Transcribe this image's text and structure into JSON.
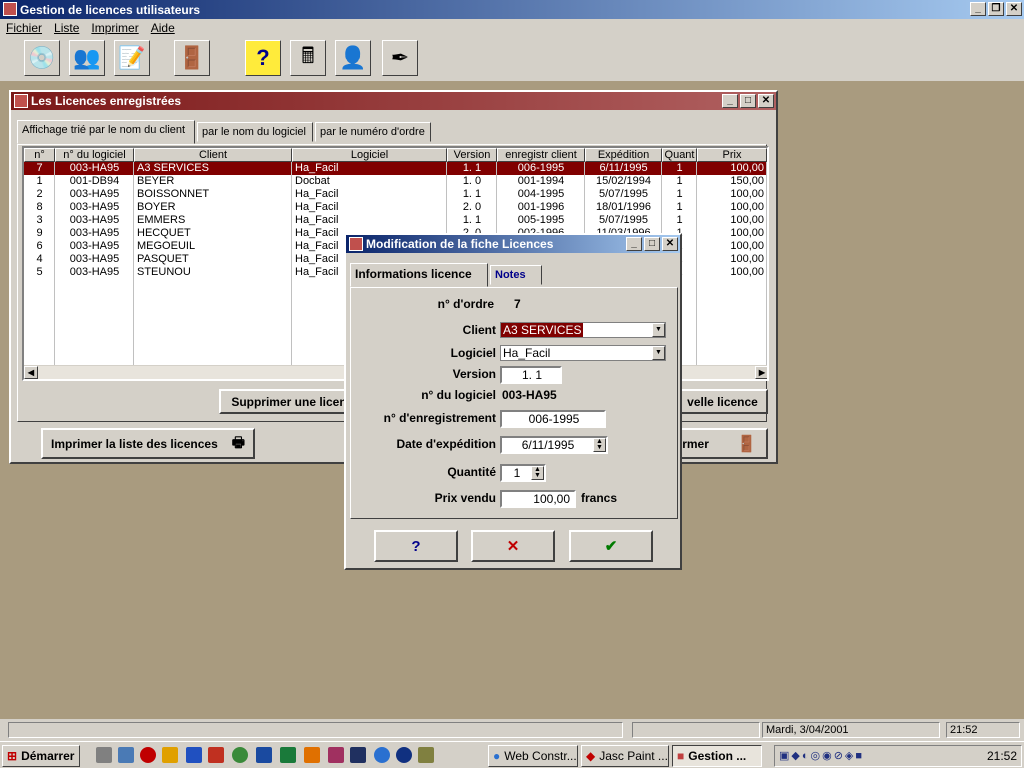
{
  "app": {
    "title": "Gestion de licences utilisateurs"
  },
  "menu": [
    "Fichier",
    "Liste",
    "Imprimer",
    "Aide"
  ],
  "toolbar_icons": [
    "cd-icon",
    "users-icon",
    "edit-icon",
    "exit-door-icon",
    "help-icon",
    "calculator-icon",
    "person-icon",
    "pen-icon"
  ],
  "licences_window": {
    "title": "Les Licences enregistrées",
    "tabs": [
      "Affichage trié par le nom du client",
      "par le nom du logiciel",
      "par le numéro d'ordre"
    ],
    "columns": [
      "n°",
      "n° du logiciel",
      "Client",
      "Logiciel",
      "Version",
      "enregistr client",
      "Expédition",
      "Quant",
      "Prix"
    ],
    "rows": [
      [
        "7",
        "003-HA95",
        "A3 SERVICES",
        "Ha_Facil",
        "1. 1",
        "006-1995",
        "6/11/1995",
        "1",
        "100,00"
      ],
      [
        "1",
        "001-DB94",
        "BEYER",
        "Docbat",
        "1. 0",
        "001-1994",
        "15/02/1994",
        "1",
        "150,00"
      ],
      [
        "2",
        "003-HA95",
        "BOISSONNET",
        "Ha_Facil",
        "1. 1",
        "004-1995",
        "5/07/1995",
        "1",
        "100,00"
      ],
      [
        "8",
        "003-HA95",
        "BOYER",
        "Ha_Facil",
        "2. 0",
        "001-1996",
        "18/01/1996",
        "1",
        "100,00"
      ],
      [
        "3",
        "003-HA95",
        "EMMERS",
        "Ha_Facil",
        "1. 1",
        "005-1995",
        "5/07/1995",
        "1",
        "100,00"
      ],
      [
        "9",
        "003-HA95",
        "HECQUET",
        "Ha_Facil",
        "2. 0",
        "002-1996",
        "11/03/1996",
        "1",
        "100,00"
      ],
      [
        "6",
        "003-HA95",
        "MEGOEUIL",
        "Ha_Facil",
        "",
        "",
        "",
        "1",
        "100,00"
      ],
      [
        "4",
        "003-HA95",
        "PASQUET",
        "Ha_Facil",
        "",
        "",
        "",
        "1",
        "100,00"
      ],
      [
        "5",
        "003-HA95",
        "STEUNOU",
        "Ha_Facil",
        "",
        "",
        "",
        "1",
        "100,00"
      ]
    ],
    "btn_delete": "Supprimer une licen",
    "btn_new": "velle licence",
    "btn_print": "Imprimer la liste des licences",
    "btn_close": "rmer"
  },
  "dialog": {
    "title": "Modification de la fiche Licences",
    "tabs": [
      "Informations licence",
      "Notes"
    ],
    "fields": {
      "ordre_label": "n° d'ordre",
      "ordre_value": "7",
      "client_label": "Client",
      "client_value": "A3 SERVICES",
      "logiciel_label": "Logiciel",
      "logiciel_value": "Ha_Facil",
      "version_label": "Version",
      "version_value": "1. 1",
      "nlogiciel_label": "n° du logiciel",
      "nlogiciel_value": "003-HA95",
      "enreg_label": "n°  d'enregistrement",
      "enreg_value": "006-1995",
      "date_label": "Date d'expédition",
      "date_value": "6/11/1995",
      "qty_label": "Quantité",
      "qty_value": "1",
      "prix_label": "Prix vendu",
      "prix_value": "100,00",
      "prix_unit": "francs"
    },
    "btn_help": "?",
    "btn_cancel": "✕",
    "btn_ok": "✔"
  },
  "status": {
    "date": "Mardi, 3/04/2001",
    "time": "21:52"
  },
  "taskbar": {
    "start": "Démarrer",
    "tasks": [
      "Web Constr...",
      "Jasc Paint ...",
      "Gestion ..."
    ],
    "clock": "21:52"
  },
  "colors": {
    "titlebar_active": "#0a246a",
    "titlebar_inactive": "#7b1818",
    "selection": "#800000",
    "desktop": "#a99b7f"
  }
}
